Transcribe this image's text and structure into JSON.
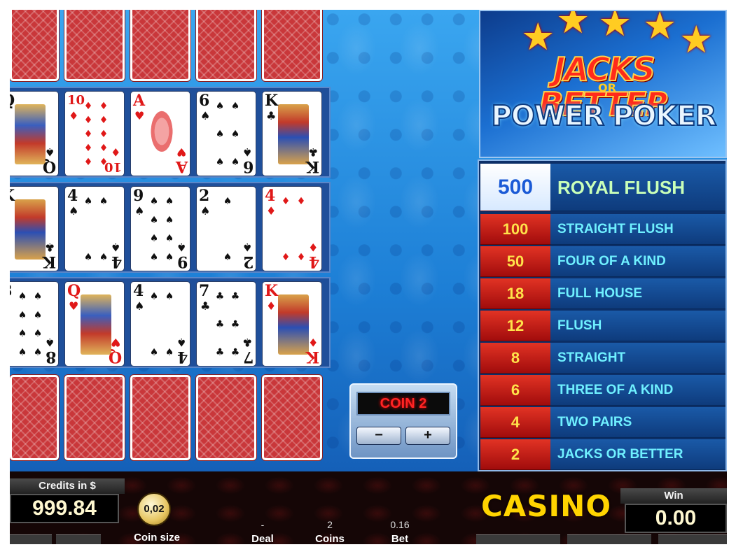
{
  "game": {
    "logo_line1": "JACKS BETTER",
    "logo_or": "OR",
    "logo_line2": "POWER POKER"
  },
  "paytable": [
    {
      "payout": "500",
      "hand": "ROYAL FLUSH"
    },
    {
      "payout": "100",
      "hand": "STRAIGHT FLUSH"
    },
    {
      "payout": "50",
      "hand": "FOUR OF A KIND"
    },
    {
      "payout": "18",
      "hand": "FULL HOUSE"
    },
    {
      "payout": "12",
      "hand": "FLUSH"
    },
    {
      "payout": "8",
      "hand": "STRAIGHT"
    },
    {
      "payout": "6",
      "hand": "THREE OF A KIND"
    },
    {
      "payout": "4",
      "hand": "TWO PAIRS"
    },
    {
      "payout": "2",
      "hand": "JACKS OR BETTER"
    }
  ],
  "hands": {
    "row1": [
      {
        "rank": "Q",
        "suit": "♠",
        "color": "black"
      },
      {
        "rank": "10",
        "suit": "♦",
        "color": "red"
      },
      {
        "rank": "A",
        "suit": "♥",
        "color": "red"
      },
      {
        "rank": "6",
        "suit": "♠",
        "color": "black"
      },
      {
        "rank": "K",
        "suit": "♣",
        "color": "black"
      }
    ],
    "row2": [
      {
        "rank": "K",
        "suit": "♣",
        "color": "black"
      },
      {
        "rank": "4",
        "suit": "♠",
        "color": "black"
      },
      {
        "rank": "9",
        "suit": "♠",
        "color": "black"
      },
      {
        "rank": "2",
        "suit": "♠",
        "color": "black"
      },
      {
        "rank": "4",
        "suit": "♦",
        "color": "red"
      }
    ],
    "row3": [
      {
        "rank": "8",
        "suit": "♠",
        "color": "black"
      },
      {
        "rank": "Q",
        "suit": "♥",
        "color": "red"
      },
      {
        "rank": "4",
        "suit": "♠",
        "color": "black"
      },
      {
        "rank": "7",
        "suit": "♣",
        "color": "black"
      },
      {
        "rank": "K",
        "suit": "♦",
        "color": "red"
      }
    ]
  },
  "coin_control": {
    "label": "COIN 2",
    "minus": "−",
    "plus": "+"
  },
  "bottom": {
    "credits_label": "Credits in $",
    "credits_value": "999.84",
    "coin_size_value": "0,02",
    "coin_size_label": "Coin size",
    "deal_value": "-",
    "deal_label": "Deal",
    "coins_value": "2",
    "coins_label": "Coins",
    "bet_value": "0.16",
    "bet_label": "Bet",
    "brand": "CASINO",
    "win_label": "Win",
    "win_value": "0.00"
  },
  "colors": {
    "card_red": "#e01818",
    "paytable_value_bg": "#c21d16",
    "paytable_text": "#6ff0ff",
    "casino_yellow": "#ffd400"
  }
}
